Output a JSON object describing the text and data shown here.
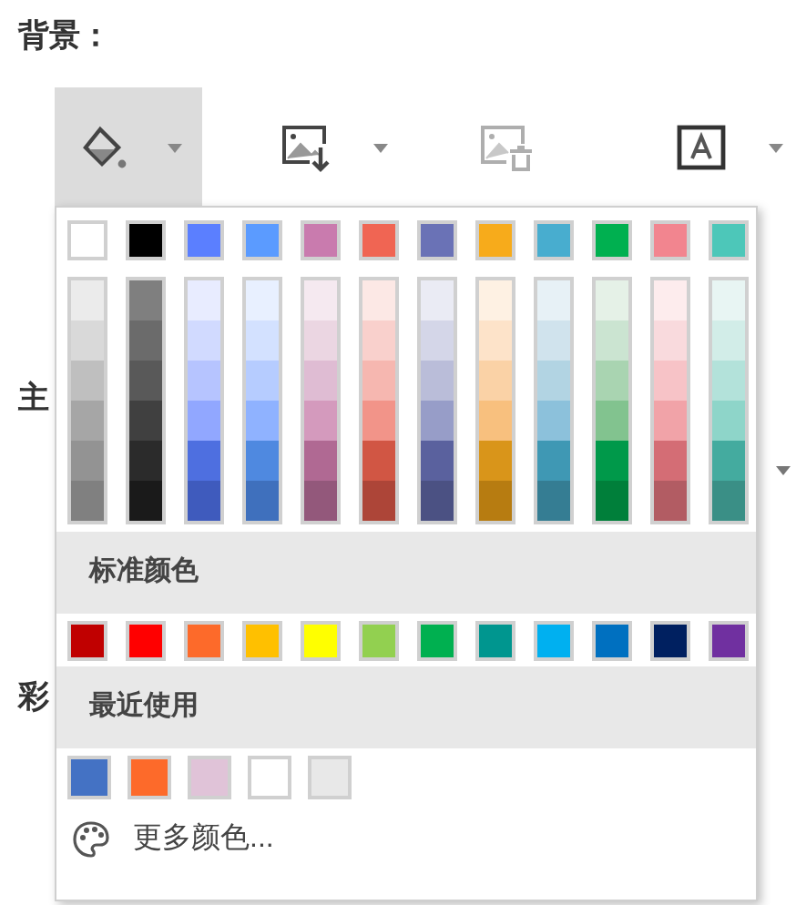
{
  "title": "背景：",
  "toolbar": [
    {
      "kind": "fill",
      "selected": true,
      "disabled": false,
      "menu": true
    },
    {
      "kind": "image-insert",
      "selected": false,
      "disabled": false,
      "menu": true
    },
    {
      "kind": "image-delete",
      "selected": false,
      "disabled": true,
      "menu": false
    },
    {
      "kind": "text-box",
      "selected": false,
      "disabled": false,
      "menu": true
    }
  ],
  "background_labels": [
    "主",
    "彩"
  ],
  "color_menu": {
    "theme_colors": [
      {
        "color": "#ffffff",
        "shades": [
          {
            "color": "#ebebeb"
          },
          {
            "color": "#d9d9d9"
          },
          {
            "color": "#bfbfbf"
          },
          {
            "color": "#a6a6a6"
          },
          {
            "color": "#939393"
          },
          {
            "color": "#808080"
          }
        ]
      },
      {
        "color": "#000000",
        "shades": [
          {
            "color": "#7f7f7f"
          },
          {
            "color": "#6b6b6b"
          },
          {
            "color": "#595959"
          },
          {
            "color": "#404040"
          },
          {
            "color": "#2b2b2b"
          },
          {
            "color": "#1a1a1a"
          }
        ]
      },
      {
        "color": "#5b7fff",
        "shades": [
          {
            "color": "#e8ecff"
          },
          {
            "color": "#d1daff"
          },
          {
            "color": "#b6c4ff"
          },
          {
            "color": "#91a7ff"
          },
          {
            "color": "#4e6fe0"
          },
          {
            "color": "#3f5bbd"
          }
        ]
      },
      {
        "color": "#5b9bff",
        "shades": [
          {
            "color": "#e8f0ff"
          },
          {
            "color": "#d3e1ff"
          },
          {
            "color": "#b6ccff"
          },
          {
            "color": "#8fb2ff"
          },
          {
            "color": "#4f89e0"
          },
          {
            "color": "#3f70bd"
          }
        ]
      },
      {
        "color": "#c97bae",
        "shades": [
          {
            "color": "#f5e9f0"
          },
          {
            "color": "#ebd6e2"
          },
          {
            "color": "#dfbcd3"
          },
          {
            "color": "#d49abd"
          },
          {
            "color": "#b06993"
          },
          {
            "color": "#93587b"
          }
        ]
      },
      {
        "color": "#f06553",
        "shades": [
          {
            "color": "#fce8e5"
          },
          {
            "color": "#f9d0cc"
          },
          {
            "color": "#f6b7b0"
          },
          {
            "color": "#f29489"
          },
          {
            "color": "#d15644"
          },
          {
            "color": "#ad4538"
          }
        ]
      },
      {
        "color": "#6a72b6",
        "shades": [
          {
            "color": "#eaebf4"
          },
          {
            "color": "#d4d6e8"
          },
          {
            "color": "#babdd9"
          },
          {
            "color": "#979dc8"
          },
          {
            "color": "#5a619e"
          },
          {
            "color": "#4b5183"
          }
        ]
      },
      {
        "color": "#f7ab1b",
        "shades": [
          {
            "color": "#fef1e3"
          },
          {
            "color": "#fde3c9"
          },
          {
            "color": "#fad2a6"
          },
          {
            "color": "#f8c07e"
          },
          {
            "color": "#d9951a"
          },
          {
            "color": "#b77c11"
          }
        ]
      },
      {
        "color": "#48adcf",
        "shades": [
          {
            "color": "#e7f1f6"
          },
          {
            "color": "#d0e3ed"
          },
          {
            "color": "#b2d4e3"
          },
          {
            "color": "#8cc1db"
          },
          {
            "color": "#3f98b4"
          },
          {
            "color": "#357d93"
          }
        ]
      },
      {
        "color": "#00b050",
        "shades": [
          {
            "color": "#e5f1e7"
          },
          {
            "color": "#cbe4d1"
          },
          {
            "color": "#a9d4b1"
          },
          {
            "color": "#82c38f"
          },
          {
            "color": "#00994a"
          },
          {
            "color": "#007f3a"
          }
        ]
      },
      {
        "color": "#f2858f",
        "shades": [
          {
            "color": "#fdeced"
          },
          {
            "color": "#f9dadd"
          },
          {
            "color": "#f7c3c7"
          },
          {
            "color": "#f1a3a8"
          },
          {
            "color": "#d46d75"
          },
          {
            "color": "#b25c63"
          }
        ]
      },
      {
        "color": "#4dc7b9",
        "shades": [
          {
            "color": "#e8f5f3"
          },
          {
            "color": "#d2ede8"
          },
          {
            "color": "#b3e2da"
          },
          {
            "color": "#8ed5c9"
          },
          {
            "color": "#44ab9f"
          },
          {
            "color": "#3a8f86"
          }
        ]
      }
    ],
    "standard_title": "标准颜色",
    "standard_colors": [
      {
        "color": "#c00000"
      },
      {
        "color": "#ff0000"
      },
      {
        "color": "#fd6a2a"
      },
      {
        "color": "#ffc000"
      },
      {
        "color": "#ffff00"
      },
      {
        "color": "#92d050"
      },
      {
        "color": "#00b050"
      },
      {
        "color": "#00968f"
      },
      {
        "color": "#00b0f0"
      },
      {
        "color": "#0070c0"
      },
      {
        "color": "#002060"
      },
      {
        "color": "#7030a0"
      }
    ],
    "recent_title": "最近使用",
    "recent_colors": [
      {
        "color": "#4472c4"
      },
      {
        "color": "#fd6a2a"
      },
      {
        "color": "#e0c3d8"
      },
      {
        "color": "#ffffff"
      },
      {
        "color": "#e8e8e8"
      }
    ],
    "more_colors": "更多颜色..."
  }
}
